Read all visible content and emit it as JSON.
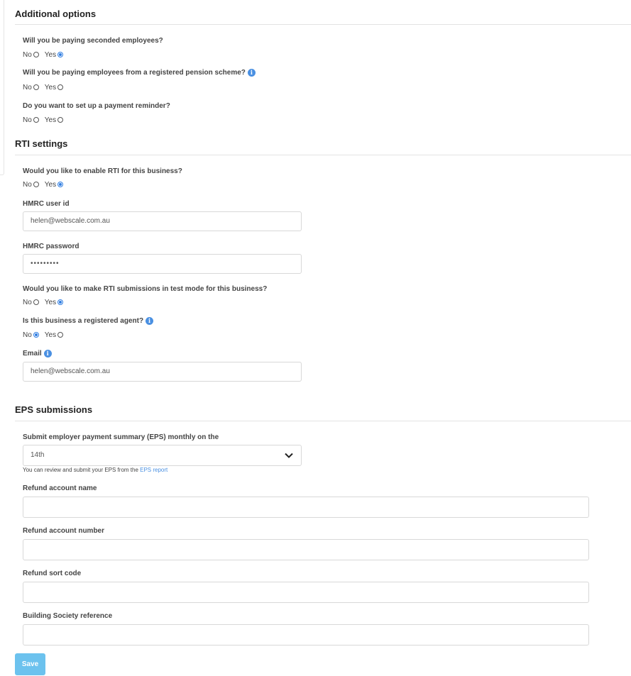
{
  "additional": {
    "title": "Additional options",
    "q1": "Will you be paying seconded employees?",
    "q2": "Will you be paying employees from a registered pension scheme?",
    "q3": "Do you want to set up a payment reminder?"
  },
  "radio": {
    "no": "No",
    "yes": "Yes"
  },
  "rti": {
    "title": "RTI settings",
    "q_enable": "Would you like to enable RTI for this business?",
    "user_label": "HMRC user id",
    "user_value": "helen@webscale.com.au",
    "password_label": "HMRC password",
    "password_value": "•••••••••",
    "q_test": "Would you like to make RTI submissions in test mode for this business?",
    "q_agent": "Is this business a registered agent?",
    "email_label": "Email",
    "email_value": "helen@webscale.com.au"
  },
  "eps": {
    "title": "EPS submissions",
    "submit_label": "Submit employer payment summary (EPS) monthly on the",
    "submit_value": "14th",
    "hint_text": "You can review and submit your EPS from the ",
    "hint_link": "EPS report",
    "refund_name_label": "Refund account name",
    "refund_number_label": "Refund account number",
    "sort_code_label": "Refund sort code",
    "building_society_label": "Building Society reference"
  },
  "save_label": "Save",
  "colors": {
    "accent": "#2f7de1",
    "save_button": "#6cc2ee",
    "info_icon": "#4a90e2",
    "link": "#4a90e2"
  },
  "icons": [
    "info-icon",
    "chevron-down-icon"
  ]
}
